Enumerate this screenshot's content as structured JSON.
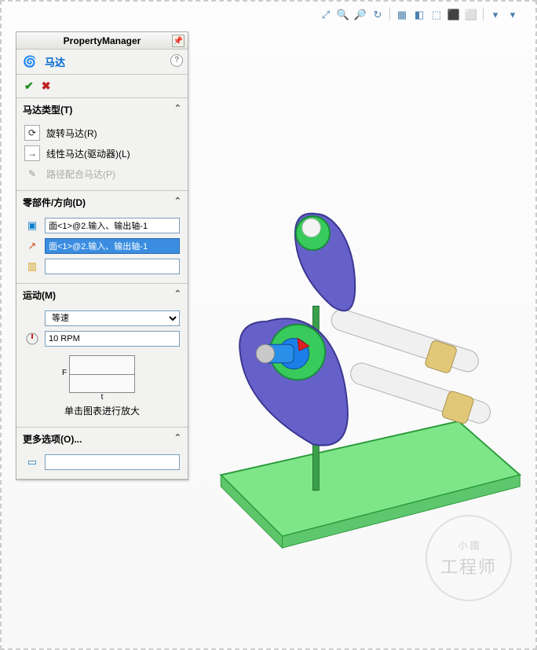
{
  "pm": {
    "header": "PropertyManager",
    "title": "马达",
    "motor_type": {
      "heading": "马达类型(T)",
      "rotary": "旋转马达(R)",
      "linear": "线性马达(驱动器)(L)",
      "path": "路径配合马达(P)"
    },
    "component": {
      "heading": "零部件/方向(D)",
      "face1": "面<1>@2.输入、输出轴-1",
      "dir1": "面<1>@2.输入、输出轴-1",
      "relative": ""
    },
    "motion": {
      "heading": "运动(M)",
      "type": "等速",
      "speed": "10 RPM",
      "chart_f": "F",
      "chart_t": "t",
      "chart_caption": "单击图表进行放大"
    },
    "more": {
      "heading": "更多选项(O)...",
      "load": ""
    }
  },
  "watermark": {
    "line1": "小 國",
    "line2": "工程师"
  }
}
